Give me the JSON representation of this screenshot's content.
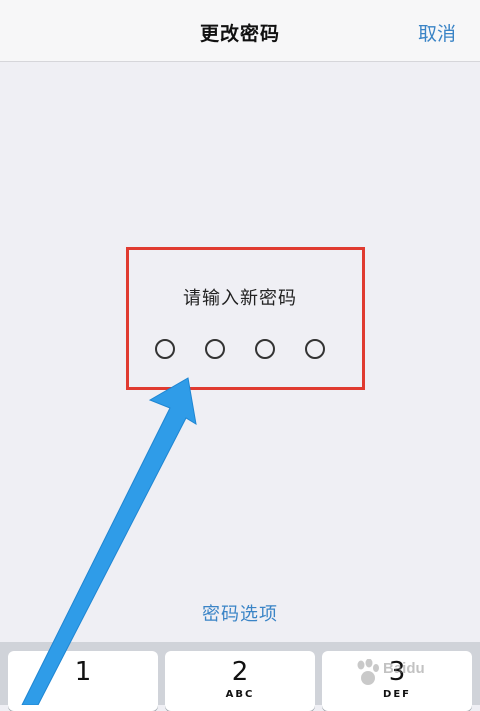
{
  "nav": {
    "title": "更改密码",
    "cancel_label": "取消"
  },
  "passcode": {
    "prompt": "请输入新密码",
    "length": 4,
    "entered": 0
  },
  "options_link": "密码选项",
  "keypad": {
    "keys": [
      {
        "digit": "1",
        "letters": ""
      },
      {
        "digit": "2",
        "letters": "ABC"
      },
      {
        "digit": "3",
        "letters": "DEF"
      }
    ]
  },
  "watermark": {
    "text": "Baidu"
  },
  "colors": {
    "accent": "#3a84c6",
    "highlight": "#e03a30",
    "arrow": "#2f9ce8",
    "background": "#efeff4"
  }
}
